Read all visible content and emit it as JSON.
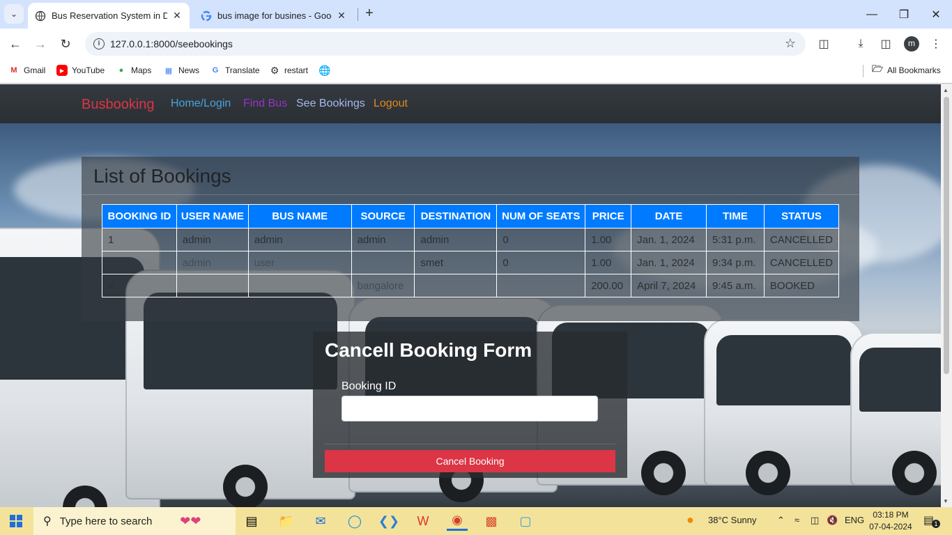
{
  "browser": {
    "tabs": [
      {
        "title": "Bus Reservation System in Djan",
        "active": true
      },
      {
        "title": "bus image for busines - Google",
        "active": false
      }
    ],
    "url": "127.0.0.1:8000/seebookings",
    "profile_initial": "m",
    "bookmarks": [
      "Gmail",
      "YouTube",
      "Maps",
      "News",
      "Translate",
      "restart"
    ],
    "all_bookmarks": "All Bookmarks"
  },
  "navbar": {
    "brand": "Busbooking",
    "links": [
      {
        "label": "Home/Login",
        "color": "#4aa3df"
      },
      {
        "label": "Find Bus",
        "color": "#9b30c8"
      },
      {
        "label": "See Bookings",
        "color": "#a7b8f0"
      },
      {
        "label": "Logout",
        "color": "#e3891f"
      }
    ]
  },
  "bookings": {
    "heading": "List of Bookings",
    "columns": [
      "BOOKING ID",
      "USER NAME",
      "BUS NAME",
      "SOURCE",
      "DESTINATION",
      "NUM OF SEATS",
      "PRICE",
      "DATE",
      "TIME",
      "STATUS"
    ],
    "rows": [
      [
        "1",
        "admin",
        "admin",
        "admin",
        "admin",
        "0",
        "1.00",
        "Jan. 1, 2024",
        "5:31 p.m.",
        "CANCELLED"
      ],
      [
        "",
        "admin",
        "user",
        "",
        "smet",
        "0",
        "1.00",
        "Jan. 1, 2024",
        "9:34 p.m.",
        "CANCELLED"
      ],
      [
        "4",
        "",
        "",
        "bangalore",
        "",
        "",
        "200.00",
        "April 7, 2024",
        "9:45 a.m.",
        "BOOKED"
      ]
    ]
  },
  "cancel_form": {
    "title": "Cancell Booking Form",
    "label": "Booking ID",
    "value": "",
    "button": "Cancel Booking"
  },
  "taskbar": {
    "search_placeholder": "Type here to search",
    "weather": "38°C  Sunny",
    "language": "ENG",
    "time": "03:18 PM",
    "date": "07-04-2024",
    "notifications": "1"
  },
  "colors": {
    "primary": "#007bff",
    "danger": "#dc3545",
    "navbar": "#343a40"
  }
}
